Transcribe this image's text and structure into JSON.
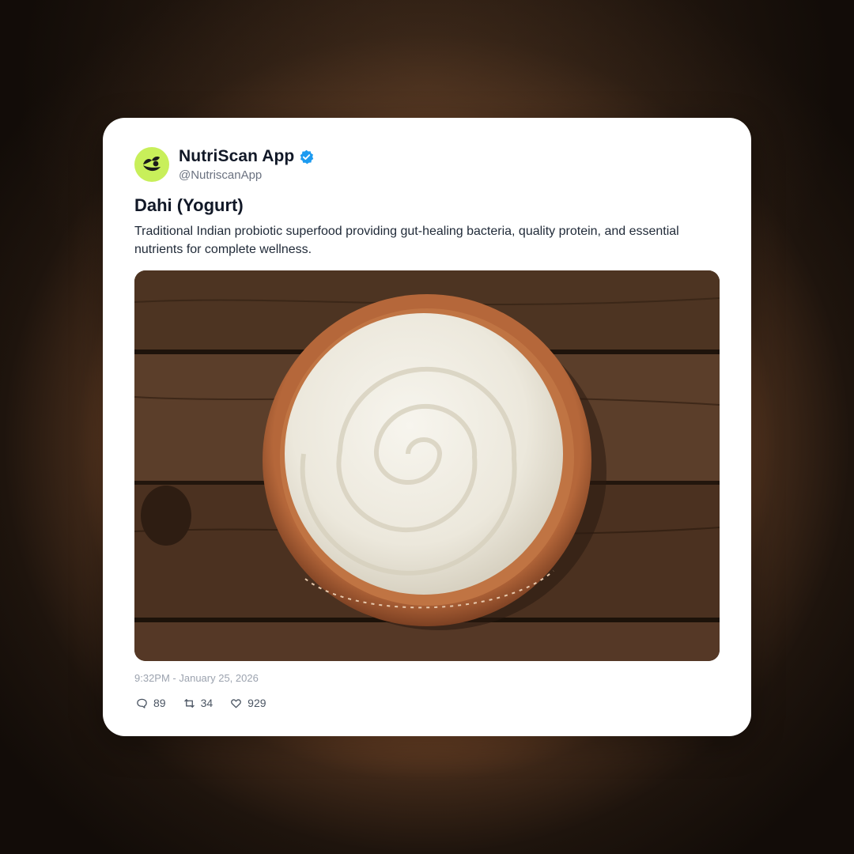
{
  "account": {
    "name": "NutriScan App",
    "handle": "@NutriscanApp",
    "verified": true,
    "avatar_icon": "leaf-logo-icon",
    "avatar_color": "#c8ef5a",
    "verified_color": "#1d9bf0"
  },
  "post": {
    "title": "Dahi (Yogurt)",
    "description": "Traditional Indian probiotic superfood providing gut-healing bacteria, quality protein, and essential nutrients for complete wellness.",
    "image_subject": "bowl-of-yogurt-photo",
    "timestamp": "9:32PM - January 25, 2026"
  },
  "stats": {
    "replies": "89",
    "reposts": "34",
    "likes": "929"
  }
}
